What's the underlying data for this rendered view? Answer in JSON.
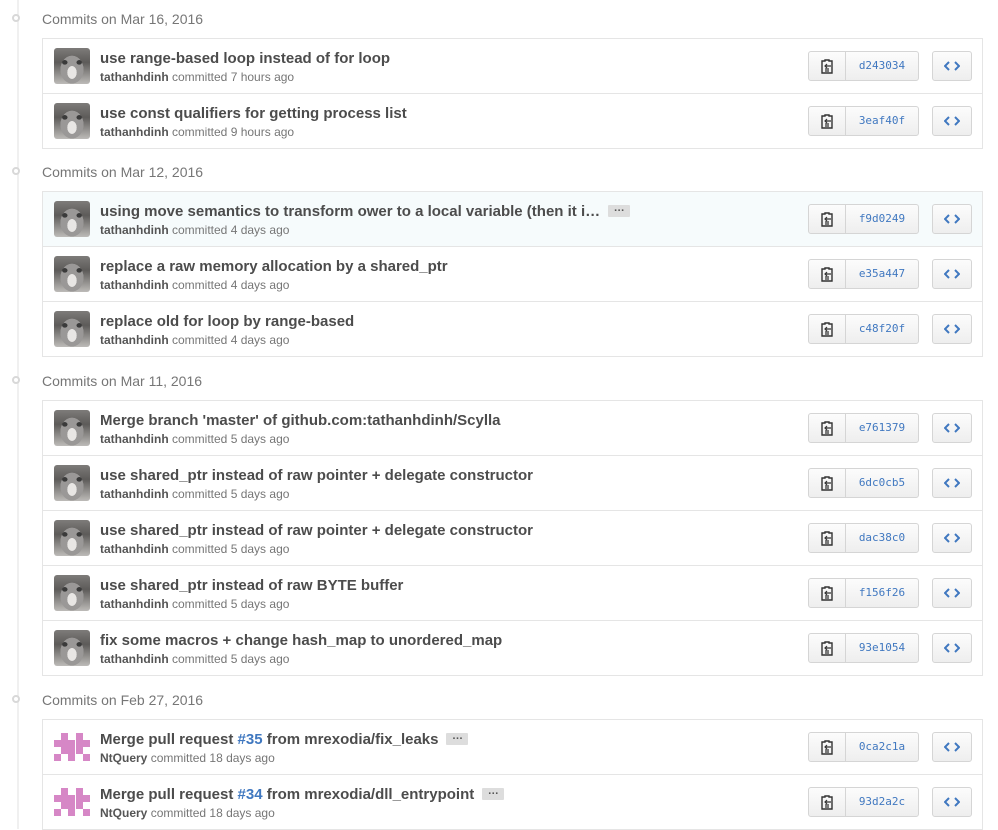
{
  "groups": [
    {
      "heading": "Commits on Mar 16, 2016",
      "commits": [
        {
          "title": "use range-based loop instead of for loop",
          "author": "tathanhdinh",
          "verb": "committed",
          "time": "7 hours ago",
          "sha": "d243034",
          "avatar": "wolf-avatar"
        },
        {
          "title": "use const qualifiers for getting process list",
          "author": "tathanhdinh",
          "verb": "committed",
          "time": "9 hours ago",
          "sha": "3eaf40f",
          "avatar": "wolf-avatar"
        }
      ]
    },
    {
      "heading": "Commits on Mar 12, 2016",
      "commits": [
        {
          "title": "using move semantics to transform ower to a local variable (then it i…",
          "author": "tathanhdinh",
          "verb": "committed",
          "time": "4 days ago",
          "sha": "f9d0249",
          "avatar": "wolf-avatar",
          "expand": "…"
        },
        {
          "title": "replace a raw memory allocation by a shared_ptr",
          "author": "tathanhdinh",
          "verb": "committed",
          "time": "4 days ago",
          "sha": "e35a447",
          "avatar": "wolf-avatar"
        },
        {
          "title": "replace old for loop by range-based",
          "author": "tathanhdinh",
          "verb": "committed",
          "time": "4 days ago",
          "sha": "c48f20f",
          "avatar": "wolf-avatar"
        }
      ]
    },
    {
      "heading": "Commits on Mar 11, 2016",
      "commits": [
        {
          "title": "Merge branch 'master' of github.com:tathanhdinh/Scylla",
          "author": "tathanhdinh",
          "verb": "committed",
          "time": "5 days ago",
          "sha": "e761379",
          "avatar": "wolf-avatar"
        },
        {
          "title": "use shared_ptr instead of raw pointer + delegate constructor",
          "author": "tathanhdinh",
          "verb": "committed",
          "time": "5 days ago",
          "sha": "6dc0cb5",
          "avatar": "wolf-avatar"
        },
        {
          "title": "use shared_ptr instead of raw pointer + delegate constructor",
          "author": "tathanhdinh",
          "verb": "committed",
          "time": "5 days ago",
          "sha": "dac38c0",
          "avatar": "wolf-avatar"
        },
        {
          "title": "use shared_ptr instead of raw BYTE buffer",
          "author": "tathanhdinh",
          "verb": "committed",
          "time": "5 days ago",
          "sha": "f156f26",
          "avatar": "wolf-avatar"
        },
        {
          "title": "fix some macros + change hash_map to unordered_map",
          "author": "tathanhdinh",
          "verb": "committed",
          "time": "5 days ago",
          "sha": "93e1054",
          "avatar": "wolf-avatar"
        }
      ]
    },
    {
      "heading": "Commits on Feb 27, 2016",
      "commits": [
        {
          "title_pre": "Merge pull request ",
          "pr": "#35",
          "title_post": " from mrexodia/fix_leaks",
          "author": "NtQuery",
          "verb": "committed",
          "time": "18 days ago",
          "sha": "0ca2c1a",
          "avatar": "identicon-avatar",
          "expand": "…"
        },
        {
          "title_pre": "Merge pull request ",
          "pr": "#34",
          "title_post": " from mrexodia/dll_entrypoint",
          "author": "NtQuery",
          "verb": "committed",
          "time": "18 days ago",
          "sha": "93d2a2c",
          "avatar": "identicon-avatar",
          "expand": "…"
        }
      ]
    }
  ],
  "icons": {
    "copy": "clippy-icon",
    "browse": "code-icon"
  },
  "colors": {
    "link": "#4078c0",
    "identicon": "#d687c6",
    "hover_row": "#f6fbfc"
  }
}
